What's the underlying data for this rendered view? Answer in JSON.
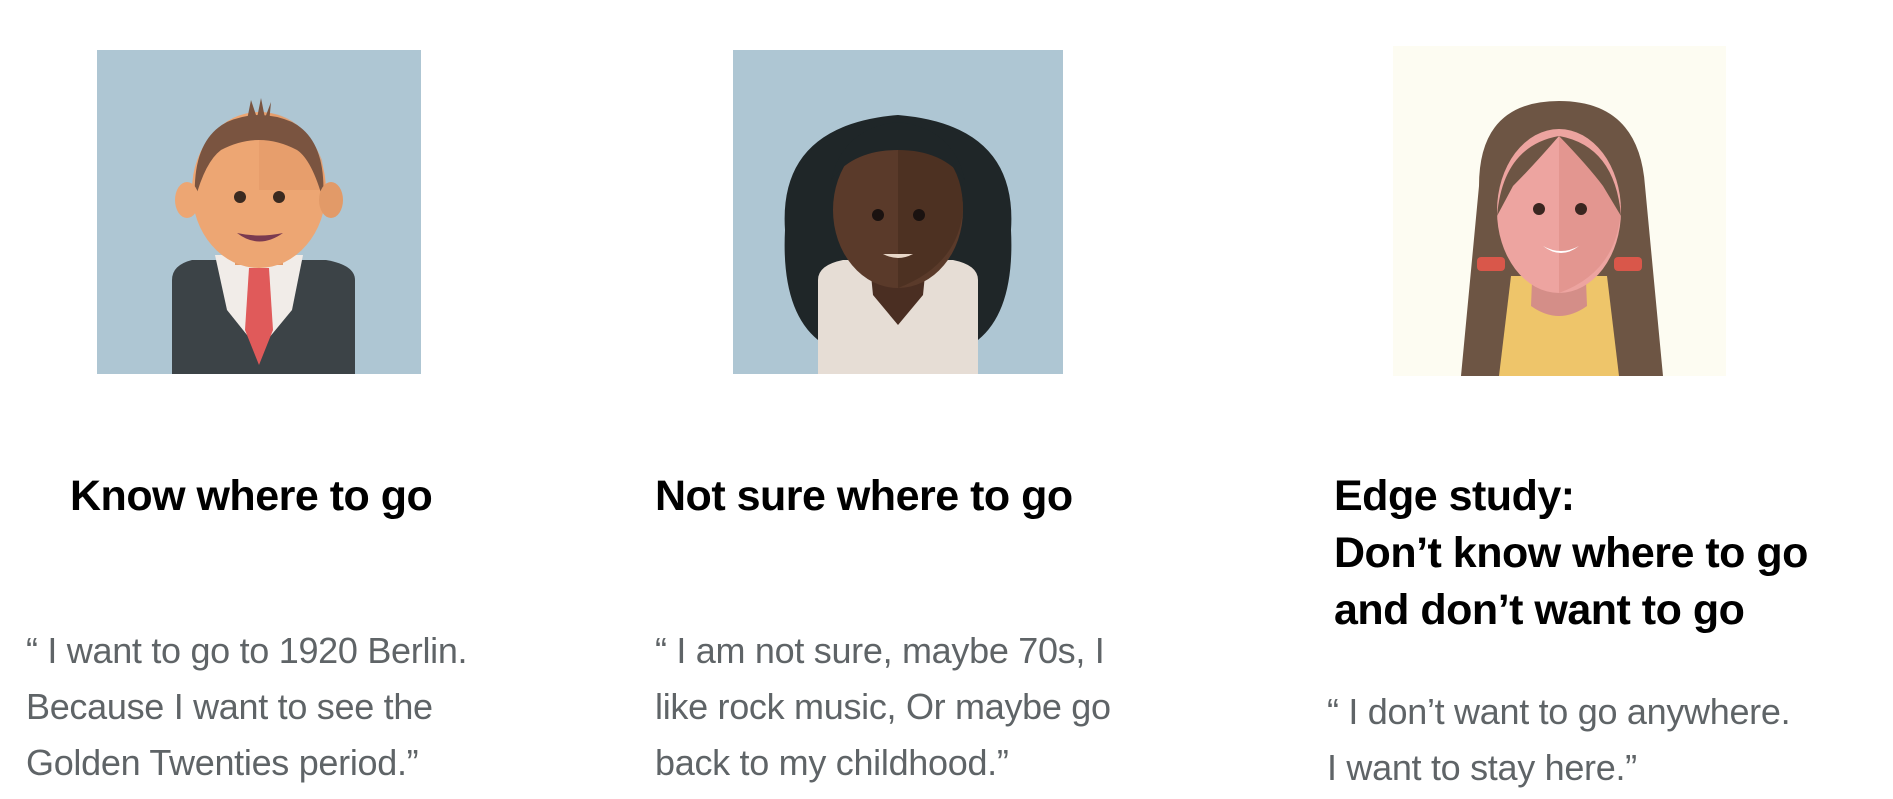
{
  "personas": [
    {
      "avatar": "man-in-suit-avatar",
      "background": "#aec6d3",
      "heading": [
        "Know where to go"
      ],
      "quote": [
        "“ I want to go to 1920 Berlin.",
        "Because I want to see the",
        "Golden Twenties period.”"
      ]
    },
    {
      "avatar": "woman-dark-hair-avatar",
      "background": "#aec6d3",
      "heading": [
        "Not sure where to go"
      ],
      "quote": [
        "“ I am not sure, maybe 70s, I",
        "like rock music, Or maybe go",
        "back to my childhood.”"
      ]
    },
    {
      "avatar": "girl-brown-hair-avatar",
      "background": "#fdfcf2",
      "heading": [
        "Edge study:",
        "Don’t know where to go",
        "and don’t want to go"
      ],
      "quote": [
        "“ I don’t want to go anywhere.",
        "I want to stay here.”"
      ]
    }
  ]
}
